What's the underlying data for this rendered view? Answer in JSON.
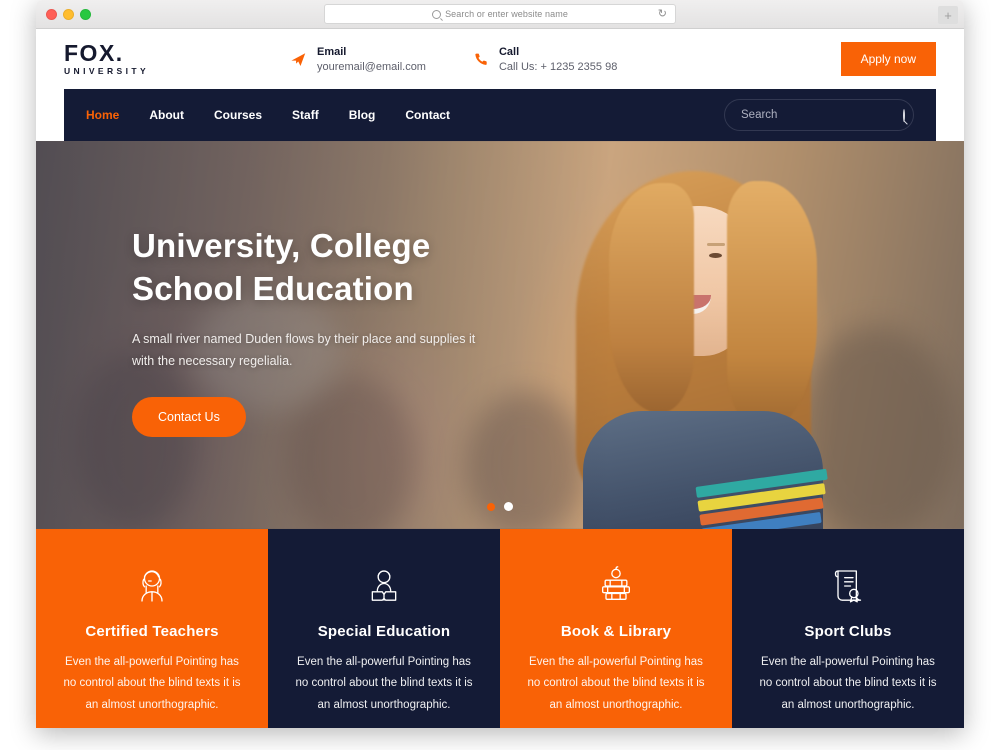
{
  "browser": {
    "url_placeholder": "Search or enter website name",
    "reload_icon": "reload-icon",
    "newtab_label": "+",
    "traffic_lights": [
      "close",
      "minimize",
      "maximize"
    ]
  },
  "colors": {
    "accent_orange": "#F96206",
    "dark_navy": "#141B36",
    "white": "#FFFFFF"
  },
  "header": {
    "logo": {
      "brand": "FOX.",
      "sub": "UNIVERSITY"
    },
    "contacts": [
      {
        "icon": "paper-plane-icon",
        "label": "Email",
        "value": "youremail@email.com"
      },
      {
        "icon": "phone-icon",
        "label": "Call",
        "value": "Call Us: + 1235 2355 98"
      }
    ],
    "apply_label": "Apply now"
  },
  "nav": {
    "items": [
      {
        "label": "Home",
        "active": true
      },
      {
        "label": "About",
        "active": false
      },
      {
        "label": "Courses",
        "active": false
      },
      {
        "label": "Staff",
        "active": false
      },
      {
        "label": "Blog",
        "active": false
      },
      {
        "label": "Contact",
        "active": false
      }
    ],
    "search": {
      "value": "",
      "placeholder": "Search",
      "icon": "search-icon"
    }
  },
  "hero": {
    "title_line1": "University, College",
    "title_line2": "School Education",
    "subtitle": "A small river named Duden flows by their place and supplies it with the necessary regelialia.",
    "cta_label": "Contact Us",
    "slider": {
      "count": 2,
      "active_index": 1
    }
  },
  "features": [
    {
      "icon": "teacher-icon",
      "title": "Certified Teachers",
      "desc": "Even the all-powerful Pointing has no control about the blind texts it is an almost unorthographic.",
      "theme": "orange"
    },
    {
      "icon": "student-reading-icon",
      "title": "Special Education",
      "desc": "Even the all-powerful Pointing has no control about the blind texts it is an almost unorthographic.",
      "theme": "navy"
    },
    {
      "icon": "books-apple-icon",
      "title": "Book & Library",
      "desc": "Even the all-powerful Pointing has no control about the blind texts it is an almost unorthographic.",
      "theme": "orange"
    },
    {
      "icon": "certificate-icon",
      "title": "Sport Clubs",
      "desc": "Even the all-powerful Pointing has no control about the blind texts it is an almost unorthographic.",
      "theme": "navy"
    }
  ]
}
